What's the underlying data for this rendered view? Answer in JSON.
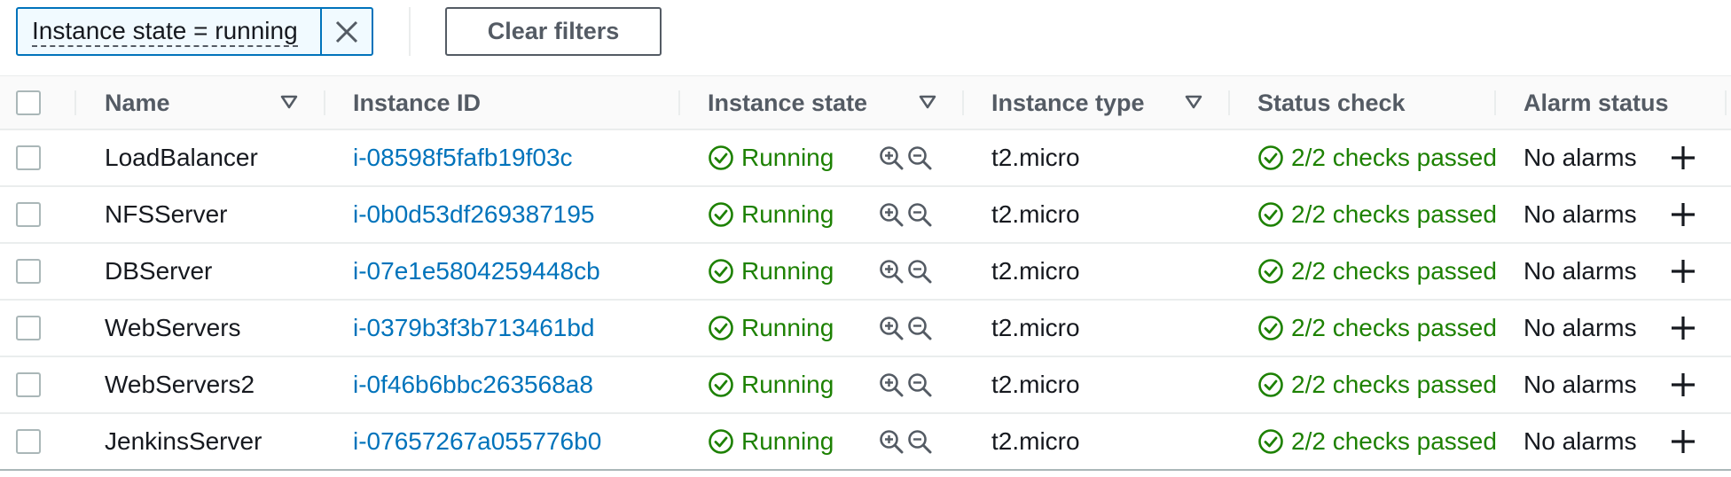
{
  "filter": {
    "token_label": "Instance state = running",
    "clear_label": "Clear filters"
  },
  "table": {
    "columns": {
      "name": "Name",
      "instance_id": "Instance ID",
      "instance_state": "Instance state",
      "instance_type": "Instance type",
      "status_check": "Status check",
      "alarm_status": "Alarm status"
    },
    "rows": [
      {
        "name": "LoadBalancer",
        "instance_id": "i-08598f5fafb19f03c",
        "state": "Running",
        "type": "t2.micro",
        "status": "2/2 checks passed",
        "alarm": "No alarms"
      },
      {
        "name": "NFSServer",
        "instance_id": "i-0b0d53df269387195",
        "state": "Running",
        "type": "t2.micro",
        "status": "2/2 checks passed",
        "alarm": "No alarms"
      },
      {
        "name": "DBServer",
        "instance_id": "i-07e1e5804259448cb",
        "state": "Running",
        "type": "t2.micro",
        "status": "2/2 checks passed",
        "alarm": "No alarms"
      },
      {
        "name": "WebServers",
        "instance_id": "i-0379b3f3b713461bd",
        "state": "Running",
        "type": "t2.micro",
        "status": "2/2 checks passed",
        "alarm": "No alarms"
      },
      {
        "name": "WebServers2",
        "instance_id": "i-0f46b6bbc263568a8",
        "state": "Running",
        "type": "t2.micro",
        "status": "2/2 checks passed",
        "alarm": "No alarms"
      },
      {
        "name": "JenkinsServer",
        "instance_id": "i-07657267a055776b0",
        "state": "Running",
        "type": "t2.micro",
        "status": "2/2 checks passed",
        "alarm": "No alarms"
      }
    ]
  },
  "colors": {
    "link": "#0073bb",
    "success": "#1d8102",
    "token_border": "#0073bb"
  },
  "icons": {
    "token_close": "close-icon",
    "sort": "caret-down-icon",
    "state": "check-circle-icon",
    "zoom_in": "zoom-in-icon",
    "zoom_out": "zoom-out-icon",
    "add_alarm": "plus-icon"
  }
}
